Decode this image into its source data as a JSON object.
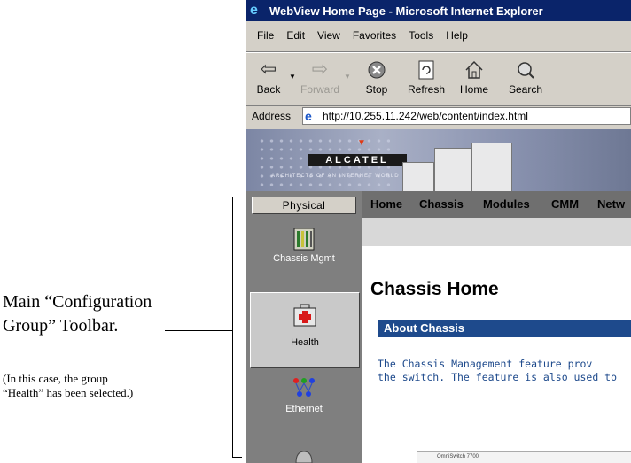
{
  "annotation": {
    "main_line1": "Main “Configuration",
    "main_line2": "Group” Toolbar.",
    "note_line1": "(In this case, the group",
    "note_line2": "“Health” has been selected.)"
  },
  "browser": {
    "title": "WebView Home Page - Microsoft Internet Explorer",
    "menu": [
      "File",
      "Edit",
      "View",
      "Favorites",
      "Tools",
      "Help"
    ],
    "toolbar": {
      "back": "Back",
      "forward": "Forward",
      "stop": "Stop",
      "refresh": "Refresh",
      "home": "Home",
      "search": "Search"
    },
    "address_label": "Address",
    "address_value": "http://10.255.11.242/web/content/index.html"
  },
  "banner": {
    "logo": "ALCATEL",
    "tagline": "ARCHITECTS OF AN INTERNET WORLD"
  },
  "sidebar": {
    "physical_button": "Physical",
    "groups": [
      {
        "label": "Chassis Mgmt",
        "icon": "chassis-mgmt-icon",
        "selected": false
      },
      {
        "label": "Health",
        "icon": "health-kit-icon",
        "selected": true
      },
      {
        "label": "Ethernet",
        "icon": "ethernet-icon",
        "selected": false
      }
    ]
  },
  "nav": {
    "items": [
      "Home",
      "Chassis",
      "Modules",
      "CMM",
      "Netw"
    ]
  },
  "page": {
    "title": "Chassis Home",
    "section_header": "About Chassis",
    "body_line1": "The Chassis Management feature prov",
    "body_line2": "the switch. The feature is also used to",
    "thumb_caption": "OmniSwitch 7700"
  },
  "colors": {
    "titlebar": "#0a246a",
    "section_header": "#1e4a8c",
    "sidebar": "#7f7f7f"
  }
}
